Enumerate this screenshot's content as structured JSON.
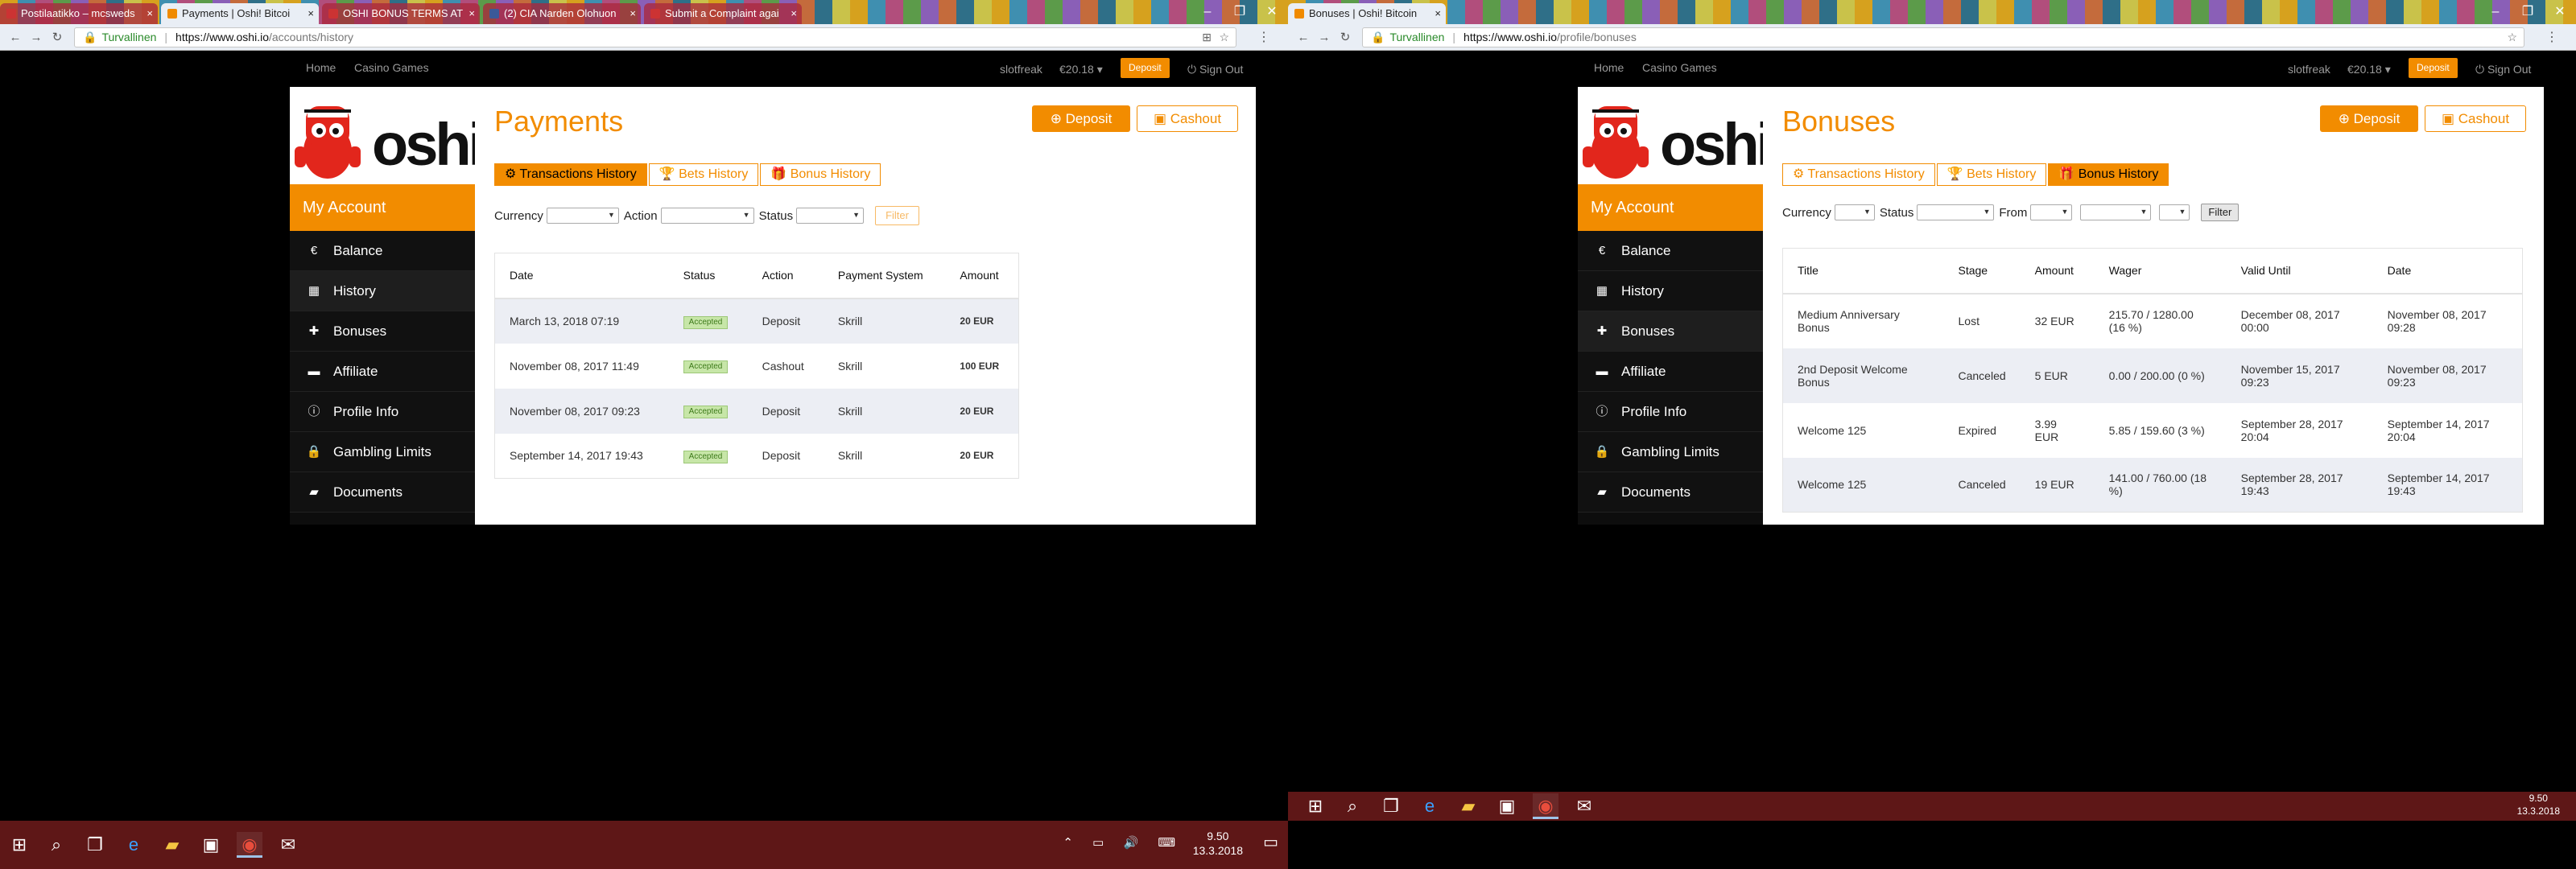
{
  "left": {
    "tabs": [
      {
        "label": "Postilaatikko – mcsweds",
        "active": false
      },
      {
        "label": "Payments | Oshi! Bitcoi",
        "active": true
      },
      {
        "label": "OSHI BONUS TERMS AT",
        "active": false
      },
      {
        "label": "(2) CIA Narden Olohuon",
        "active": false
      },
      {
        "label": "Submit a Complaint agai",
        "active": false
      }
    ],
    "address": {
      "secure_label": "Turvallinen",
      "host": "https://www.oshi.io",
      "path": "/accounts/history"
    },
    "topnav": {
      "home": "Home",
      "games": "Casino Games",
      "user": "slotfreak",
      "balance": "€20.18 ▾",
      "deposit": "Deposit",
      "signout": "Sign Out"
    },
    "sidebar": {
      "logo": "oshi",
      "my_account": "My Account",
      "items": [
        {
          "label": "Balance",
          "icon": "euro-icon"
        },
        {
          "label": "History",
          "icon": "calendar-icon"
        },
        {
          "label": "Bonuses",
          "icon": "gift-icon"
        },
        {
          "label": "Affiliate",
          "icon": "briefcase-icon"
        },
        {
          "label": "Profile Info",
          "icon": "info-icon"
        },
        {
          "label": "Gambling Limits",
          "icon": "lock-icon"
        },
        {
          "label": "Documents",
          "icon": "folder-icon"
        }
      ]
    },
    "title": "Payments",
    "deposit_btn": "Deposit",
    "cashout_btn": "Cashout",
    "subtabs": [
      "Transactions History",
      "Bets History",
      "Bonus History"
    ],
    "filters": {
      "currency": "Currency",
      "action": "Action",
      "status": "Status",
      "filter_btn": "Filter"
    },
    "table": {
      "headers": [
        "Date",
        "Status",
        "Action",
        "Payment System",
        "Amount"
      ],
      "rows": [
        {
          "date": "March 13, 2018 07:19",
          "status": "Accepted",
          "action": "Deposit",
          "system": "Skrill",
          "amount": "20 EUR"
        },
        {
          "date": "November 08, 2017 11:49",
          "status": "Accepted",
          "action": "Cashout",
          "system": "Skrill",
          "amount": "100 EUR"
        },
        {
          "date": "November 08, 2017 09:23",
          "status": "Accepted",
          "action": "Deposit",
          "system": "Skrill",
          "amount": "20 EUR"
        },
        {
          "date": "September 14, 2017 19:43",
          "status": "Accepted",
          "action": "Deposit",
          "system": "Skrill",
          "amount": "20 EUR"
        }
      ]
    },
    "taskbar": {
      "time": "9.50",
      "date": "13.3.2018"
    }
  },
  "right": {
    "tabs": [
      {
        "label": "Bonuses | Oshi! Bitcoin",
        "active": true
      }
    ],
    "address": {
      "secure_label": "Turvallinen",
      "host": "https://www.oshi.io",
      "path": "/profile/bonuses"
    },
    "topnav": {
      "home": "Home",
      "games": "Casino Games",
      "user": "slotfreak",
      "balance": "€20.18 ▾",
      "deposit": "Deposit",
      "signout": "Sign Out"
    },
    "sidebar": {
      "logo": "oshi",
      "my_account": "My Account",
      "items": [
        {
          "label": "Balance"
        },
        {
          "label": "History"
        },
        {
          "label": "Bonuses"
        },
        {
          "label": "Affiliate"
        },
        {
          "label": "Profile Info"
        },
        {
          "label": "Gambling Limits"
        },
        {
          "label": "Documents"
        }
      ]
    },
    "title": "Bonuses",
    "deposit_btn": "Deposit",
    "cashout_btn": "Cashout",
    "subtabs": [
      "Transactions History",
      "Bets History",
      "Bonus History"
    ],
    "filters": {
      "currency": "Currency",
      "status": "Status",
      "from": "From",
      "filter_btn": "Filter"
    },
    "table": {
      "headers": [
        "Title",
        "Stage",
        "Amount",
        "Wager",
        "Valid Until",
        "Date"
      ],
      "rows": [
        {
          "title": "Medium Anniversary Bonus",
          "stage": "Lost",
          "amount": "32 EUR",
          "wager": "215.70 / 1280.00 (16 %)",
          "valid": "December 08, 2017 00:00",
          "date": "November 08, 2017 09:28"
        },
        {
          "title": "2nd Deposit Welcome Bonus",
          "stage": "Canceled",
          "amount": "5 EUR",
          "wager": "0.00 / 200.00 (0 %)",
          "valid": "November 15, 2017 09:23",
          "date": "November 08, 2017 09:23"
        },
        {
          "title": "Welcome 125",
          "stage": "Expired",
          "amount": "3.99 EUR",
          "wager": "5.85 / 159.60 (3 %)",
          "valid": "September 28, 2017 20:04",
          "date": "September 14, 2017 20:04"
        },
        {
          "title": "Welcome 125",
          "stage": "Canceled",
          "amount": "19 EUR",
          "wager": "141.00 / 760.00 (18 %)",
          "valid": "September 28, 2017 19:43",
          "date": "September 14, 2017 19:43"
        }
      ]
    },
    "taskbar": {
      "time": "9.50",
      "date": "13.3.2018"
    }
  },
  "colors": {
    "accent": "#f28c00",
    "sidebar_bg": "#111111",
    "taskbar": "#5e1717",
    "badge_green": "#c7e6a8"
  }
}
